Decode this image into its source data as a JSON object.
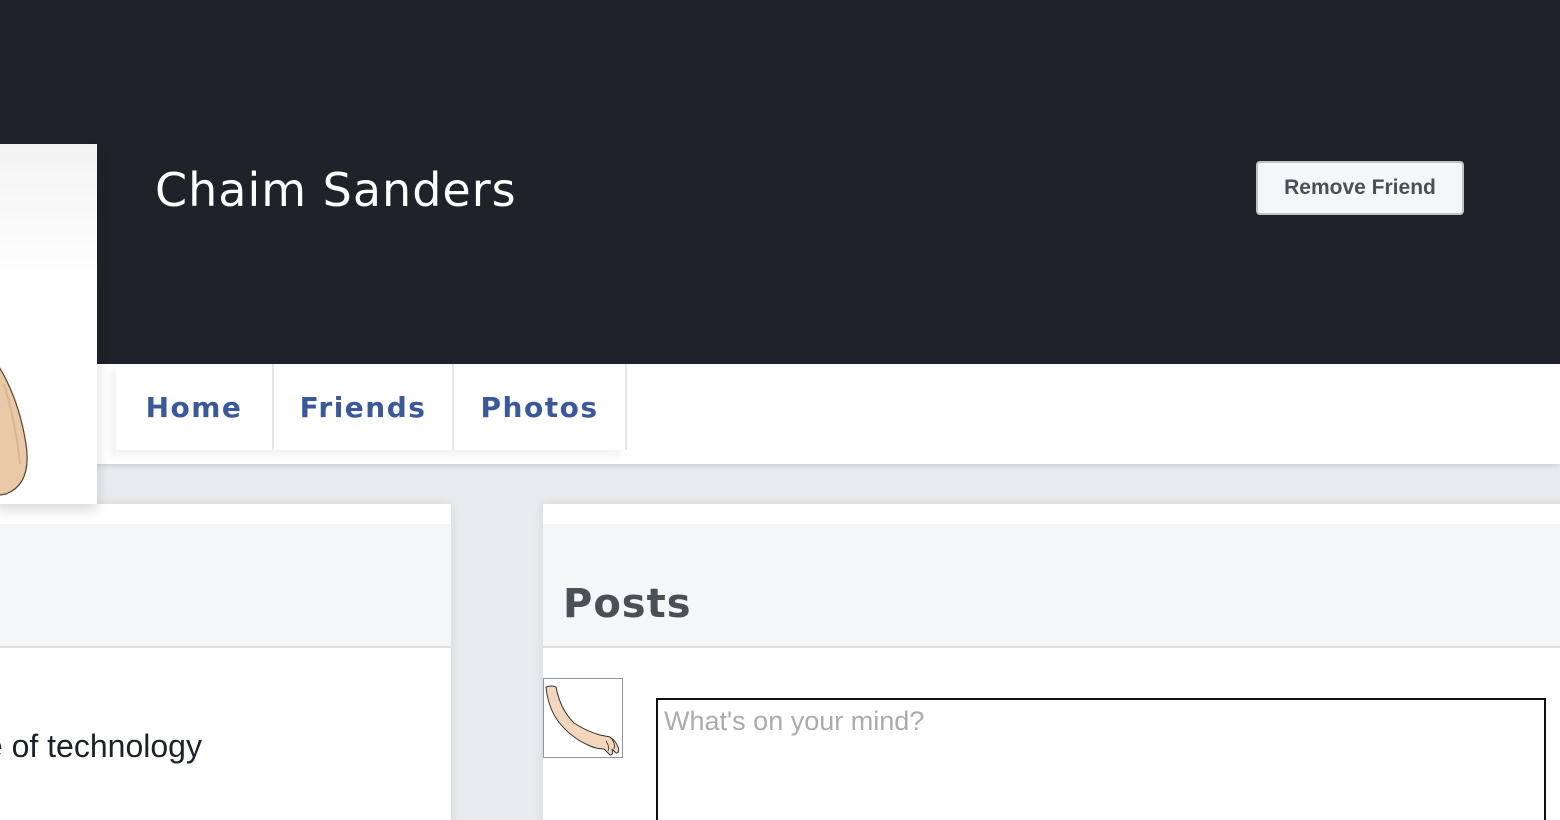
{
  "profile": {
    "name": "Chaim Sanders",
    "remove_friend_label": "Remove Friend",
    "picture_icon": "profile-photo"
  },
  "nav": {
    "tabs": [
      {
        "label": "Home"
      },
      {
        "label": "Friends"
      },
      {
        "label": "Photos"
      }
    ]
  },
  "about": {
    "text": "te of technology"
  },
  "posts": {
    "title": "Posts",
    "composer_placeholder": "What's on your mind?",
    "composer_value": "",
    "avatar_icon": "arm-hand-icon"
  },
  "colors": {
    "cover": "#20222a",
    "nav_link": "#3b5998",
    "background": "#e9ebee"
  }
}
